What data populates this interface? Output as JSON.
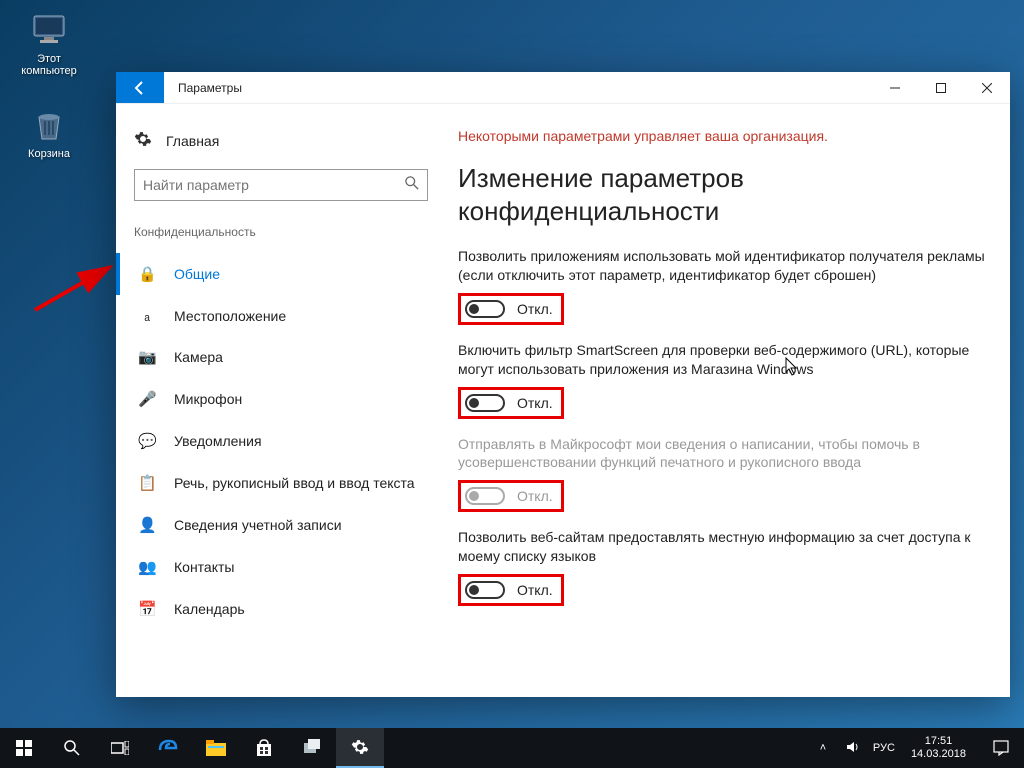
{
  "desktop": {
    "this_pc": "Этот компьютер",
    "recycle_bin": "Корзина"
  },
  "window": {
    "title": "Параметры",
    "home": "Главная",
    "search_placeholder": "Найти параметр",
    "section": "Конфиденциальность",
    "nav": [
      {
        "label": "Общие"
      },
      {
        "label": "Местоположение"
      },
      {
        "label": "Камера"
      },
      {
        "label": "Микрофон"
      },
      {
        "label": "Уведомления"
      },
      {
        "label": "Речь, рукописный ввод и ввод текста"
      },
      {
        "label": "Сведения учетной записи"
      },
      {
        "label": "Контакты"
      },
      {
        "label": "Календарь"
      }
    ]
  },
  "content": {
    "org_notice": "Некоторыми параметрами управляет ваша организация.",
    "heading": "Изменение параметров конфиденциальности",
    "settings": [
      {
        "desc": "Позволить приложениям использовать мой идентификатор получателя рекламы (если отключить этот параметр, идентификатор будет сброшен)",
        "state": "Откл.",
        "disabled": false
      },
      {
        "desc": "Включить фильтр SmartScreen для проверки веб-содержимого (URL), которые могут использовать приложения из Магазина Windows",
        "state": "Откл.",
        "disabled": false
      },
      {
        "desc": "Отправлять в Майкрософт мои сведения о написании, чтобы помочь в усовершенствовании функций печатного и рукописного ввода",
        "state": "Откл.",
        "disabled": true
      },
      {
        "desc": "Позволить веб-сайтам предоставлять местную информацию за счет доступа к моему списку языков",
        "state": "Откл.",
        "disabled": false
      }
    ]
  },
  "taskbar": {
    "lang": "РУС",
    "time": "17:51",
    "date": "14.03.2018"
  }
}
